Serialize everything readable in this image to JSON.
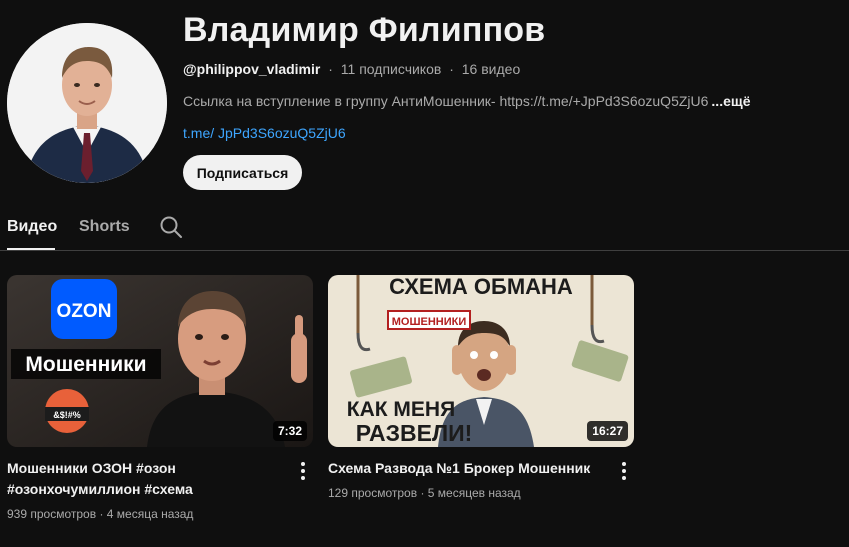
{
  "channel": {
    "name": "Владимир Филиппов",
    "handle": "@philippov_vladimir",
    "subscribers": "11 подписчиков",
    "videos_count": "16 видео",
    "separator": "·",
    "description": "Ссылка на вступление в группу АнтиМошенник- https://t.me/+JpPd3S6ozuQ5ZjU6",
    "more_label": "...ещё",
    "link": "t.me/ JpPd3S6ozuQ5ZjU6",
    "subscribe_label": "Подписаться"
  },
  "tabs": [
    {
      "label": "Видео",
      "active": true
    },
    {
      "label": "Shorts",
      "active": false
    }
  ],
  "videos": [
    {
      "title": "Мошенники ОЗОН #озон #озонхочумиллион #схема",
      "duration": "7:32",
      "views": "939 просмотров",
      "age": "4 месяца назад",
      "thumb_text": {
        "logo": "OZON",
        "caption": "Мошенники",
        "emoji_text": "&$!#%"
      }
    },
    {
      "title": "Схема Развода №1 Брокер Мошенник",
      "duration": "16:27",
      "views": "129 просмотров",
      "age": "5 месяцев назад",
      "thumb_text": {
        "top": "СХЕМА ОБМАНА",
        "sign": "МОШЕННИКИ",
        "bottom1": "КАК МЕНЯ",
        "bottom2": "РАЗВЕЛИ!"
      }
    }
  ],
  "colors": {
    "background": "#0f0f0f",
    "link": "#3ea6ff",
    "muted": "#aaaaaa",
    "ozon": "#005bff"
  }
}
